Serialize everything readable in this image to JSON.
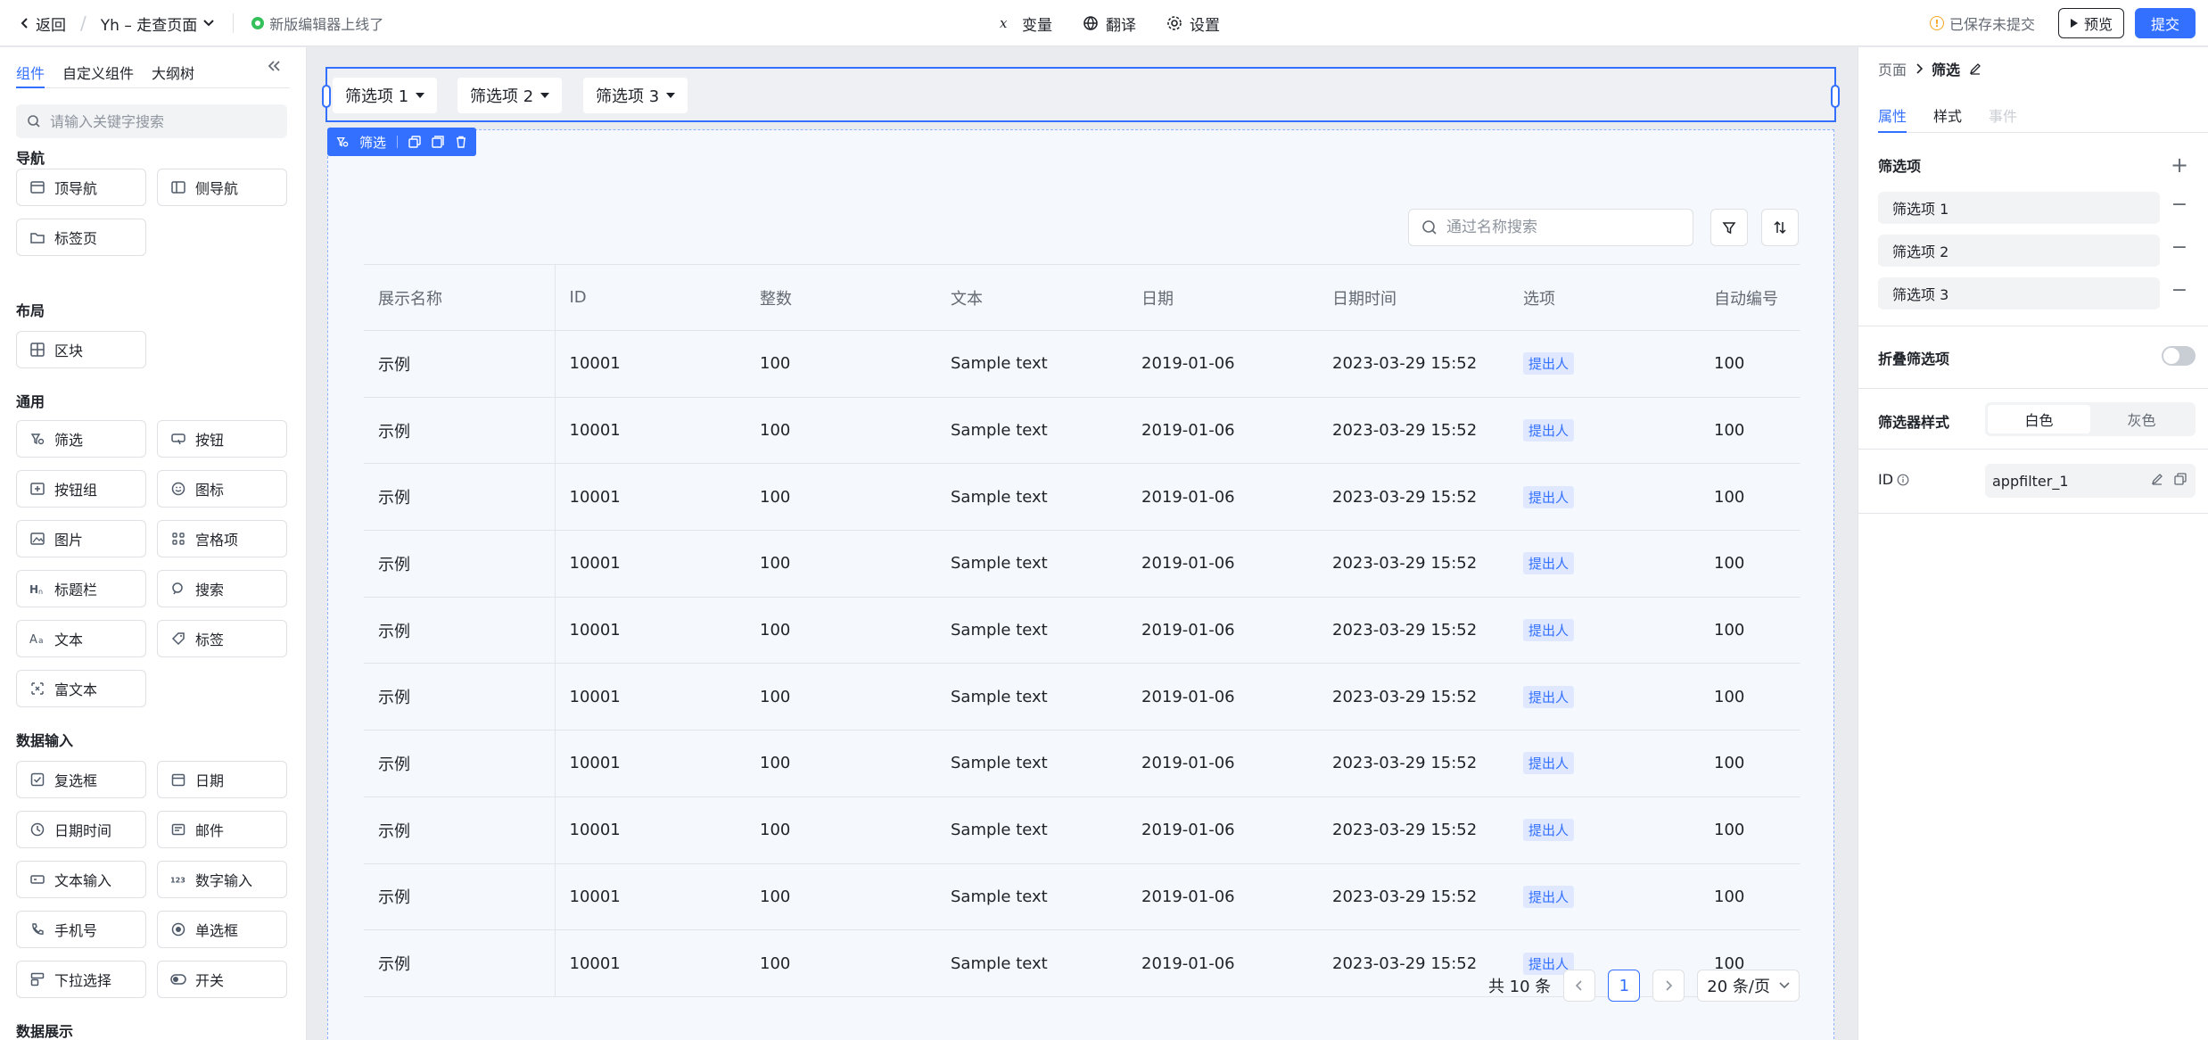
{
  "topbar": {
    "back_label": "返回",
    "project_name": "Yh – 走查页面",
    "notice": "新版编辑器上线了",
    "center_items": [
      {
        "label": "变量",
        "icon": "variable-icon"
      },
      {
        "label": "翻译",
        "icon": "globe-icon"
      },
      {
        "label": "设置",
        "icon": "gear-icon"
      }
    ],
    "save_status": "已保存未提交",
    "preview_label": "预览",
    "submit_label": "提交"
  },
  "left": {
    "tabs": [
      "组件",
      "自定义组件",
      "大纲树"
    ],
    "active_tab": 0,
    "search_placeholder": "请输入关键字搜索",
    "sections": [
      {
        "title": "导航",
        "items": [
          {
            "label": "顶导航",
            "icon": "top-nav-icon"
          },
          {
            "label": "侧导航",
            "icon": "side-nav-icon"
          },
          {
            "label": "标签页",
            "icon": "folder-tab-icon"
          }
        ]
      },
      {
        "title": "布局",
        "items": [
          {
            "label": "区块",
            "icon": "grid-block-icon"
          }
        ]
      },
      {
        "title": "通用",
        "items": [
          {
            "label": "筛选",
            "icon": "filter-icon"
          },
          {
            "label": "按钮",
            "icon": "button-icon"
          },
          {
            "label": "按钮组",
            "icon": "button-group-icon"
          },
          {
            "label": "图标",
            "icon": "smile-icon"
          },
          {
            "label": "图片",
            "icon": "image-icon"
          },
          {
            "label": "宫格项",
            "icon": "four-dots-icon"
          },
          {
            "label": "标题栏",
            "icon": "heading-icon"
          },
          {
            "label": "搜索",
            "icon": "search-icon"
          },
          {
            "label": "文本",
            "icon": "text-icon"
          },
          {
            "label": "标签",
            "icon": "tag-icon"
          },
          {
            "label": "富文本",
            "icon": "rich-text-icon"
          }
        ]
      },
      {
        "title": "数据输入",
        "items": [
          {
            "label": "复选框",
            "icon": "checkbox-icon"
          },
          {
            "label": "日期",
            "icon": "calendar-icon"
          },
          {
            "label": "日期时间",
            "icon": "clock-icon"
          },
          {
            "label": "邮件",
            "icon": "mail-icon"
          },
          {
            "label": "文本输入",
            "icon": "text-input-icon"
          },
          {
            "label": "数字输入",
            "icon": "number-input-icon"
          },
          {
            "label": "手机号",
            "icon": "phone-icon"
          },
          {
            "label": "单选框",
            "icon": "radio-icon"
          },
          {
            "label": "下拉选择",
            "icon": "dropdown-icon"
          },
          {
            "label": "开关",
            "icon": "switch-icon"
          }
        ]
      },
      {
        "title": "数据展示",
        "items": []
      }
    ]
  },
  "canvas": {
    "filters": [
      "筛选项 1",
      "筛选项 2",
      "筛选项 3"
    ],
    "selected_tag": "筛选",
    "table": {
      "search_placeholder": "通过名称搜索",
      "columns": [
        "展示名称",
        "ID",
        "整数",
        "文本",
        "日期",
        "日期时间",
        "选项",
        "自动编号"
      ],
      "rows": [
        [
          "示例",
          "10001",
          "100",
          "Sample text",
          "2019-01-06",
          "2023-03-29 15:52",
          "提出人",
          "100"
        ],
        [
          "示例",
          "10001",
          "100",
          "Sample text",
          "2019-01-06",
          "2023-03-29 15:52",
          "提出人",
          "100"
        ],
        [
          "示例",
          "10001",
          "100",
          "Sample text",
          "2019-01-06",
          "2023-03-29 15:52",
          "提出人",
          "100"
        ],
        [
          "示例",
          "10001",
          "100",
          "Sample text",
          "2019-01-06",
          "2023-03-29 15:52",
          "提出人",
          "100"
        ],
        [
          "示例",
          "10001",
          "100",
          "Sample text",
          "2019-01-06",
          "2023-03-29 15:52",
          "提出人",
          "100"
        ],
        [
          "示例",
          "10001",
          "100",
          "Sample text",
          "2019-01-06",
          "2023-03-29 15:52",
          "提出人",
          "100"
        ],
        [
          "示例",
          "10001",
          "100",
          "Sample text",
          "2019-01-06",
          "2023-03-29 15:52",
          "提出人",
          "100"
        ],
        [
          "示例",
          "10001",
          "100",
          "Sample text",
          "2019-01-06",
          "2023-03-29 15:52",
          "提出人",
          "100"
        ],
        [
          "示例",
          "10001",
          "100",
          "Sample text",
          "2019-01-06",
          "2023-03-29 15:52",
          "提出人",
          "100"
        ],
        [
          "示例",
          "10001",
          "100",
          "Sample text",
          "2019-01-06",
          "2023-03-29 15:52",
          "提出人",
          "100"
        ]
      ],
      "pager": {
        "total": "共 10 条",
        "current_page": "1",
        "page_size": "20 条/页"
      }
    }
  },
  "right": {
    "breadcrumb_root": "页面",
    "breadcrumb_current": "筛选",
    "tabs": [
      "属性",
      "样式",
      "事件"
    ],
    "filter_items_label": "筛选项",
    "filter_items": [
      "筛选项 1",
      "筛选项 2",
      "筛选项 3"
    ],
    "collapse_label": "折叠筛选项",
    "collapse_on": false,
    "style_label": "筛选器样式",
    "style_options": [
      "白色",
      "灰色"
    ],
    "style_selected": 0,
    "id_label": "ID",
    "id_value": "appfilter_1"
  },
  "colors": {
    "accent": "#3370ff",
    "canvas_bg": "#e9ebef",
    "badge_bg": "#dfe8ff"
  }
}
